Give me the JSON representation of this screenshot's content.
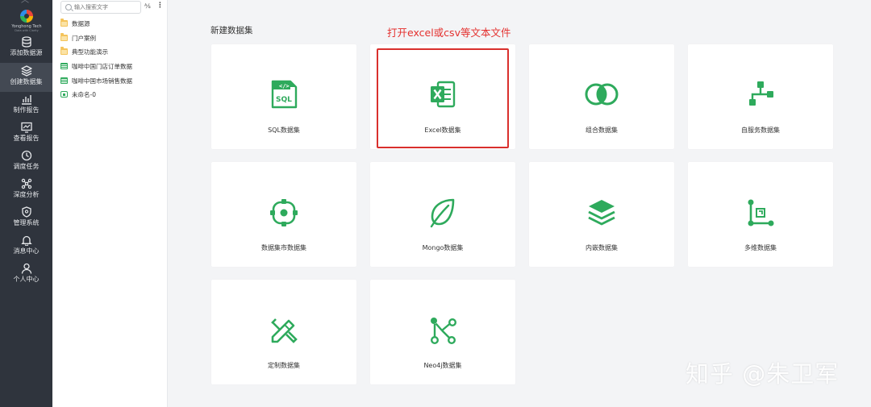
{
  "brand": {
    "name": "Yonghong Tech",
    "sub": "Data with Clarity"
  },
  "nav": [
    {
      "label": "添加数据源",
      "icon": "database-icon",
      "active": false
    },
    {
      "label": "创建数据集",
      "icon": "layers-icon",
      "active": true
    },
    {
      "label": "制作报告",
      "icon": "bar-chart-icon",
      "active": false
    },
    {
      "label": "查看报告",
      "icon": "monitor-chart-icon",
      "active": false
    },
    {
      "label": "调度任务",
      "icon": "clock-icon",
      "active": false
    },
    {
      "label": "深度分析",
      "icon": "network-icon",
      "active": false
    },
    {
      "label": "管理系统",
      "icon": "shield-icon",
      "active": false
    },
    {
      "label": "消息中心",
      "icon": "bell-icon",
      "active": false
    },
    {
      "label": "个人中心",
      "icon": "user-icon",
      "active": false
    }
  ],
  "tree": {
    "search_placeholder": "输入搜索文字",
    "items": [
      {
        "label": "数据源",
        "icon": "folder-icon"
      },
      {
        "label": "门户案例",
        "icon": "folder-icon"
      },
      {
        "label": "典型功能演示",
        "icon": "folder-icon"
      },
      {
        "label": "咖啡中国门店订单数据",
        "icon": "table-icon"
      },
      {
        "label": "咖啡中国市场销售数据",
        "icon": "table-icon"
      },
      {
        "label": "未命名-0",
        "icon": "dataset-icon"
      }
    ]
  },
  "main": {
    "title": "新建数据集",
    "annotation": "打开excel或csv等文本文件",
    "cards": [
      {
        "label": "SQL数据集",
        "icon": "sql-file-icon"
      },
      {
        "label": "Excel数据集",
        "icon": "excel-icon"
      },
      {
        "label": "组合数据集",
        "icon": "overlap-circles-icon"
      },
      {
        "label": "自服务数据集",
        "icon": "flow-icon"
      },
      {
        "label": "数据集市数据集",
        "icon": "target-icon"
      },
      {
        "label": "Mongo数据集",
        "icon": "leaf-icon"
      },
      {
        "label": "内嵌数据集",
        "icon": "stack-layers-icon"
      },
      {
        "label": "多维数据集",
        "icon": "axis-cube-icon"
      },
      {
        "label": "定制数据集",
        "icon": "pencil-ruler-icon"
      },
      {
        "label": "Neo4j数据集",
        "icon": "graph-nodes-icon"
      }
    ]
  },
  "watermark": "知乎 @朱卫军",
  "colors": {
    "accent": "#2eaa5c",
    "nav_bg": "#2f343d",
    "highlight": "#d9302d"
  }
}
